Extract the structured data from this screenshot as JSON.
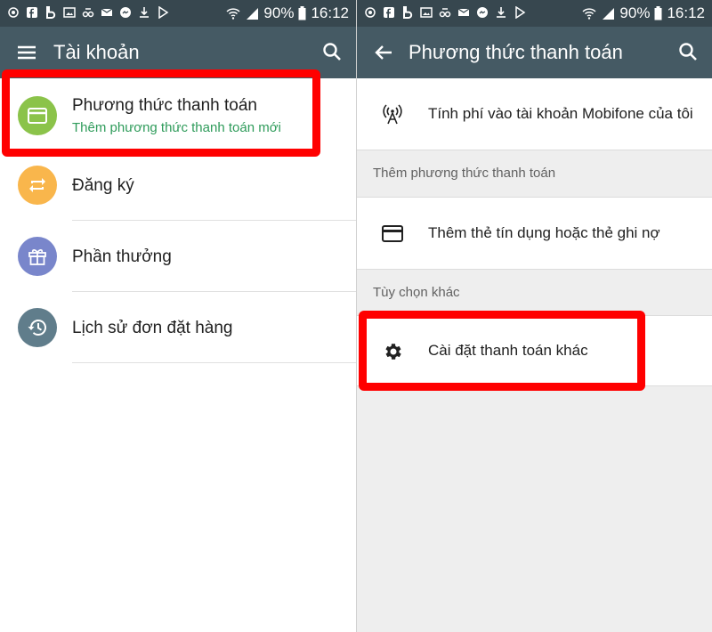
{
  "status_bar": {
    "battery_percent": "90%",
    "time": "16:12"
  },
  "left_screen": {
    "title": "Tài khoản",
    "items": [
      {
        "title": "Phương thức thanh toán",
        "subtitle": "Thêm phương thức thanh toán mới",
        "icon": "credit-card-icon",
        "color": "#8bc34a"
      },
      {
        "title": "Đăng ký",
        "icon": "repeat-icon",
        "color": "#f9b64c"
      },
      {
        "title": "Phần thưởng",
        "icon": "gift-icon",
        "color": "#7986cb"
      },
      {
        "title": "Lịch sử đơn đặt hàng",
        "icon": "history-icon",
        "color": "#607d8b"
      }
    ]
  },
  "right_screen": {
    "title": "Phương thức thanh toán",
    "carrier_billing": {
      "label": "Tính phí vào tài khoản Mobifone của tôi",
      "icon": "antenna-icon"
    },
    "add_section_header": "Thêm phương thức thanh toán",
    "add_card": {
      "label": "Thêm thẻ tín dụng hoặc thẻ ghi nợ",
      "icon": "credit-card-icon"
    },
    "other_section_header": "Tùy chọn khác",
    "other_settings": {
      "label": "Cài đặt thanh toán khác",
      "icon": "gear-icon"
    }
  },
  "colors": {
    "status_bar": "#37474f",
    "app_bar": "#455a64",
    "highlight": "#ff0000",
    "subtitle_green": "#2e9b5a"
  }
}
